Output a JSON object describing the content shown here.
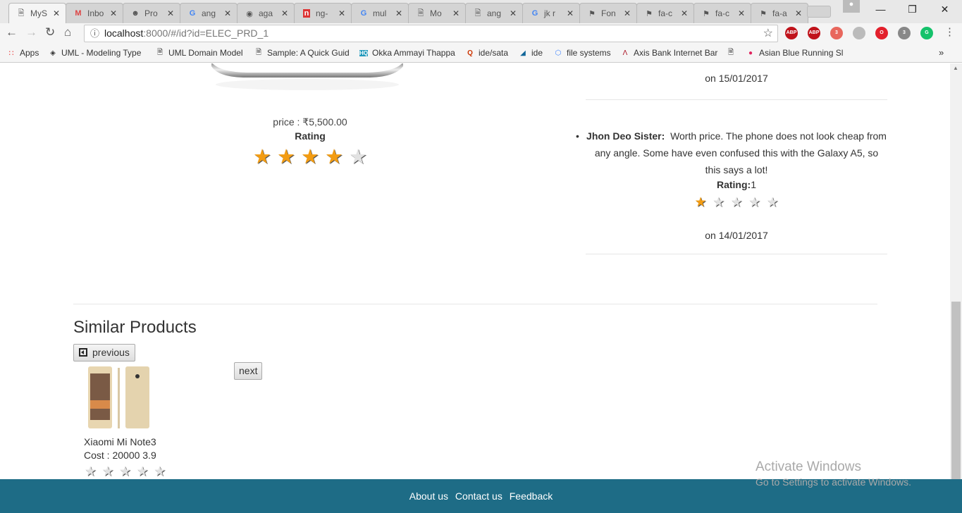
{
  "browser": {
    "tabs": [
      {
        "title": "MyS",
        "icon": "page"
      },
      {
        "title": "Inbo",
        "icon": "gmail"
      },
      {
        "title": "Pro",
        "icon": "avatar"
      },
      {
        "title": "ang",
        "icon": "google"
      },
      {
        "title": "aga",
        "icon": "github"
      },
      {
        "title": "ng-",
        "icon": "red-n"
      },
      {
        "title": "mul",
        "icon": "google"
      },
      {
        "title": "Mo",
        "icon": "page"
      },
      {
        "title": "ang",
        "icon": "page"
      },
      {
        "title": "jk r",
        "icon": "google"
      },
      {
        "title": "Fon",
        "icon": "flag"
      },
      {
        "title": "fa-c",
        "icon": "flag"
      },
      {
        "title": "fa-c",
        "icon": "flag"
      },
      {
        "title": "fa-a",
        "icon": "flag"
      }
    ],
    "url_host": "localhost",
    "url_rest": ":8000/#/id?id=ELEC_PRD_1",
    "extensions": [
      {
        "label": "ABP",
        "color": "#c0131b"
      },
      {
        "label": "ABP",
        "color": "#c0131b"
      },
      {
        "label": "3",
        "color": "#e8675d"
      },
      {
        "label": "",
        "color": "#bbbbbb"
      },
      {
        "label": "O",
        "color": "#e3202c"
      },
      {
        "label": "3",
        "color": "#888888"
      },
      {
        "label": "G",
        "color": "#15c26b"
      }
    ],
    "bookmarks": [
      "Apps",
      "UML - Modeling Type",
      "UML Domain Model",
      "Sample: A Quick Guid",
      "Okka Ammayi Thappa",
      "ide/sata",
      "ide",
      "file systems",
      "Axis Bank Internet Bar",
      "",
      "Asian Blue Running Sl"
    ],
    "more": "»"
  },
  "product": {
    "price": "price : ₹5,500.00",
    "rating_label": "Rating",
    "rating": 4,
    "max": 5
  },
  "reviews": [
    {
      "date": "on 15/01/2017"
    },
    {
      "author": "Jhon Deo Sister:",
      "text": "Worth price. The phone does not look cheap from any angle. Some have even confused this with the Galaxy A5, so this says a lot!",
      "rating_label": "Rating:",
      "rating_value": "1",
      "rating": 1,
      "date": "on 14/01/2017"
    }
  ],
  "similar": {
    "title": "Similar Products",
    "previous": "previous",
    "next": "next",
    "items": [
      {
        "name": "Xiaomi Mi Note3",
        "cost": "Cost : 20000 3.9",
        "rating": 0
      }
    ]
  },
  "footer": {
    "links": [
      "About us",
      "Contact us",
      "Feedback"
    ]
  },
  "watermark": {
    "line1": "Activate Windows",
    "line2": "Go to Settings to activate Windows."
  }
}
